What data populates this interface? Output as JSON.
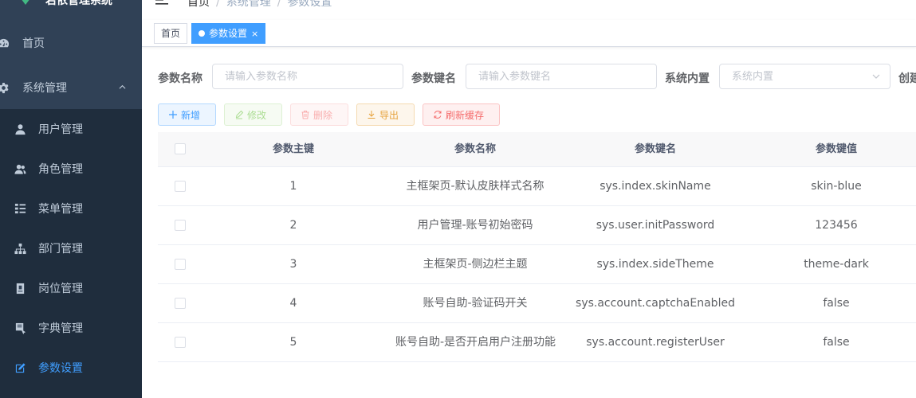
{
  "app": {
    "title": "若依管理系统"
  },
  "sidebar": {
    "items": [
      {
        "label": "首页",
        "icon": "dashboard-icon"
      },
      {
        "label": "系统管理",
        "icon": "gear-icon"
      },
      {
        "label": "用户管理",
        "icon": "user-icon"
      },
      {
        "label": "角色管理",
        "icon": "peoples-icon"
      },
      {
        "label": "菜单管理",
        "icon": "tree-table-icon"
      },
      {
        "label": "部门管理",
        "icon": "tree-icon"
      },
      {
        "label": "岗位管理",
        "icon": "post-icon"
      },
      {
        "label": "字典管理",
        "icon": "dict-icon"
      },
      {
        "label": "参数设置",
        "icon": "edit-icon"
      }
    ]
  },
  "breadcrumb": {
    "home": "首页",
    "level1": "系统管理",
    "level2": "参数设置",
    "separator": "/"
  },
  "tags": {
    "home": "首页",
    "active": "参数设置",
    "close": "×"
  },
  "search": {
    "config_name_label": "参数名称",
    "config_name_placeholder": "请输入参数名称",
    "config_key_label": "参数键名",
    "config_key_placeholder": "请输入参数键名",
    "config_type_label": "系统内置",
    "config_type_placeholder": "系统内置",
    "create_time_label": "创建"
  },
  "toolbar": {
    "add": "新增",
    "edit": "修改",
    "delete": "删除",
    "export": "导出",
    "refresh_cache": "刷新缓存"
  },
  "table": {
    "headers": [
      "参数主键",
      "参数名称",
      "参数键名",
      "参数键值"
    ],
    "rows": [
      [
        "1",
        "主框架页-默认皮肤样式名称",
        "sys.index.skinName",
        "skin-blue"
      ],
      [
        "2",
        "用户管理-账号初始密码",
        "sys.user.initPassword",
        "123456"
      ],
      [
        "3",
        "主框架页-侧边栏主题",
        "sys.index.sideTheme",
        "theme-dark"
      ],
      [
        "4",
        "账号自助-验证码开关",
        "sys.account.captchaEnabled",
        "false"
      ],
      [
        "5",
        "账号自助-是否开启用户注册功能",
        "sys.account.registerUser",
        "false"
      ]
    ]
  },
  "colors": {
    "sidebar_bg": "#304156",
    "submenu_bg": "#1f2d3d",
    "accent": "#409eff"
  }
}
